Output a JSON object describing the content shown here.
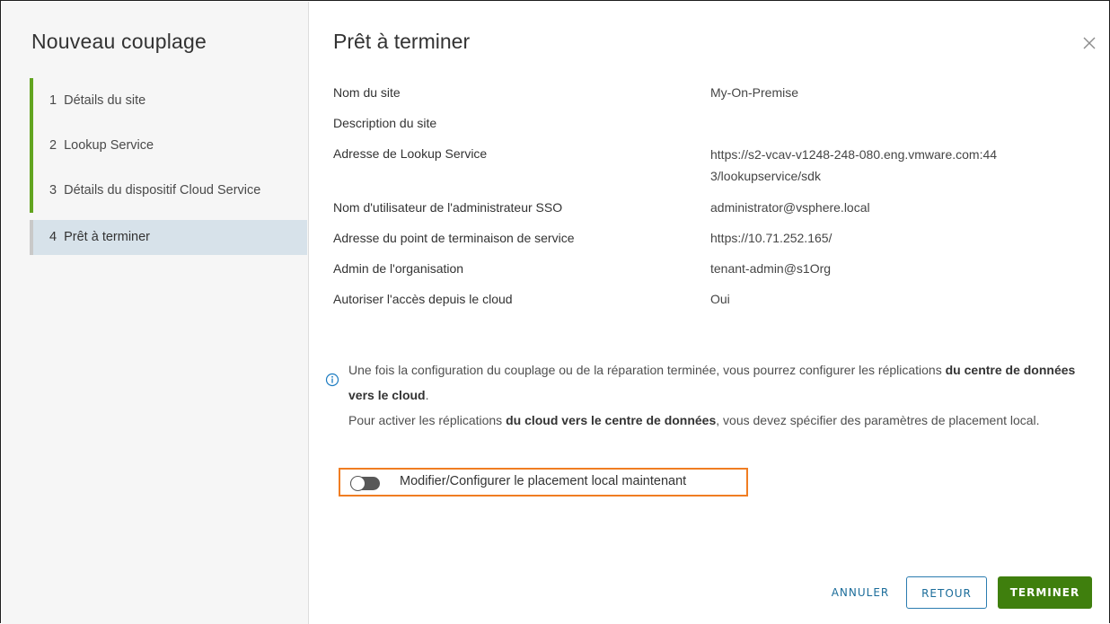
{
  "wizard": {
    "title": "Nouveau couplage",
    "steps": [
      {
        "number": "1",
        "label": "Détails du site"
      },
      {
        "number": "2",
        "label": "Lookup Service"
      },
      {
        "number": "3",
        "label": "Détails du dispositif Cloud Service"
      },
      {
        "number": "4",
        "label": "Prêt à terminer"
      }
    ],
    "active_step": 4
  },
  "page": {
    "title": "Prêt à terminer",
    "close_icon": "close-icon"
  },
  "summary": [
    {
      "label": "Nom du site",
      "value": "My-On-Premise"
    },
    {
      "label": "Description du site",
      "value": ""
    },
    {
      "label": "Adresse de Lookup Service",
      "value": "https://s2-vcav-v1248-248-080.eng.vmware.com:443/lookupservice/sdk"
    },
    {
      "label": "Nom d'utilisateur de l'administrateur SSO",
      "value": "administrator@vsphere.local"
    },
    {
      "label": "Adresse du point de terminaison de service",
      "value": "https://10.71.252.165/"
    },
    {
      "label": "Admin de l'organisation",
      "value": "tenant-admin@s1Org"
    },
    {
      "label": "Autoriser l'accès depuis le cloud",
      "value": "Oui"
    }
  ],
  "info": {
    "icon": "info-icon",
    "line1_prefix": "Une fois la configuration du couplage ou de la réparation terminée, vous pourrez configurer les réplications ",
    "line1_bold": "du centre de données vers le cloud",
    "line1_suffix": ".",
    "line2_prefix": "Pour activer les réplications ",
    "line2_bold": "du cloud vers le centre de données",
    "line2_suffix": ", vous devez spécifier des paramètres de placement local."
  },
  "toggle": {
    "label": "Modifier/Configurer le placement local maintenant",
    "checked": false,
    "highlight_color": "#f07d22"
  },
  "buttons": {
    "cancel": "ANNULER",
    "back": "RETOUR",
    "finish": "TERMINER"
  },
  "colors": {
    "accent_green": "#62a420",
    "finish_button": "#3f7f0d",
    "link_blue": "#1b6c9a",
    "active_step_bg": "#d7e2ea"
  }
}
